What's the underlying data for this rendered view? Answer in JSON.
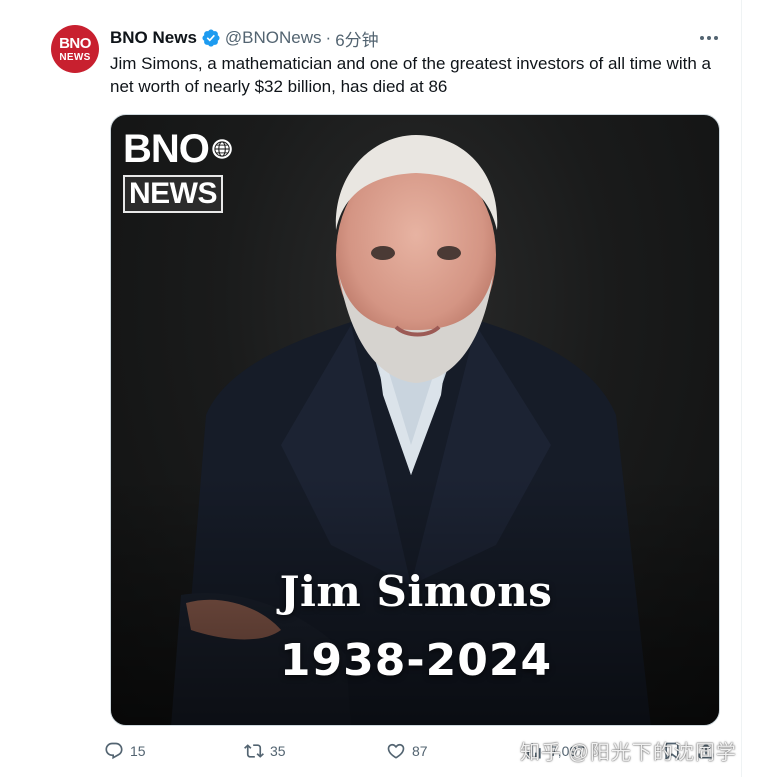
{
  "tweet": {
    "author_name": "BNO News",
    "author_handle": "@BNONews",
    "separator": "·",
    "time_ago": "6分钟",
    "avatar_top": "BNO",
    "avatar_bottom": "NEWS",
    "text": "Jim Simons, a mathematician and one of the greatest investors of all time with a net worth of nearly $32 billion, has died at 86"
  },
  "media": {
    "logo_top": "BNO",
    "logo_bottom": "NEWS",
    "caption_name": "Jim Simons",
    "caption_years": "1938-2024"
  },
  "actions": {
    "replies": "15",
    "retweets": "35",
    "likes": "87",
    "views": "7,097"
  },
  "icons": [
    "verified-badge-icon",
    "more-options-icon",
    "reply-icon",
    "retweet-icon",
    "like-icon",
    "views-icon",
    "bookmark-icon",
    "share-icon",
    "globe-icon"
  ],
  "colors": {
    "brand_red": "#c8202f",
    "verified_blue": "#1d9bf0",
    "muted": "#536471",
    "text": "#0f1419"
  },
  "watermark": "知乎 @阳光下的沈同学"
}
